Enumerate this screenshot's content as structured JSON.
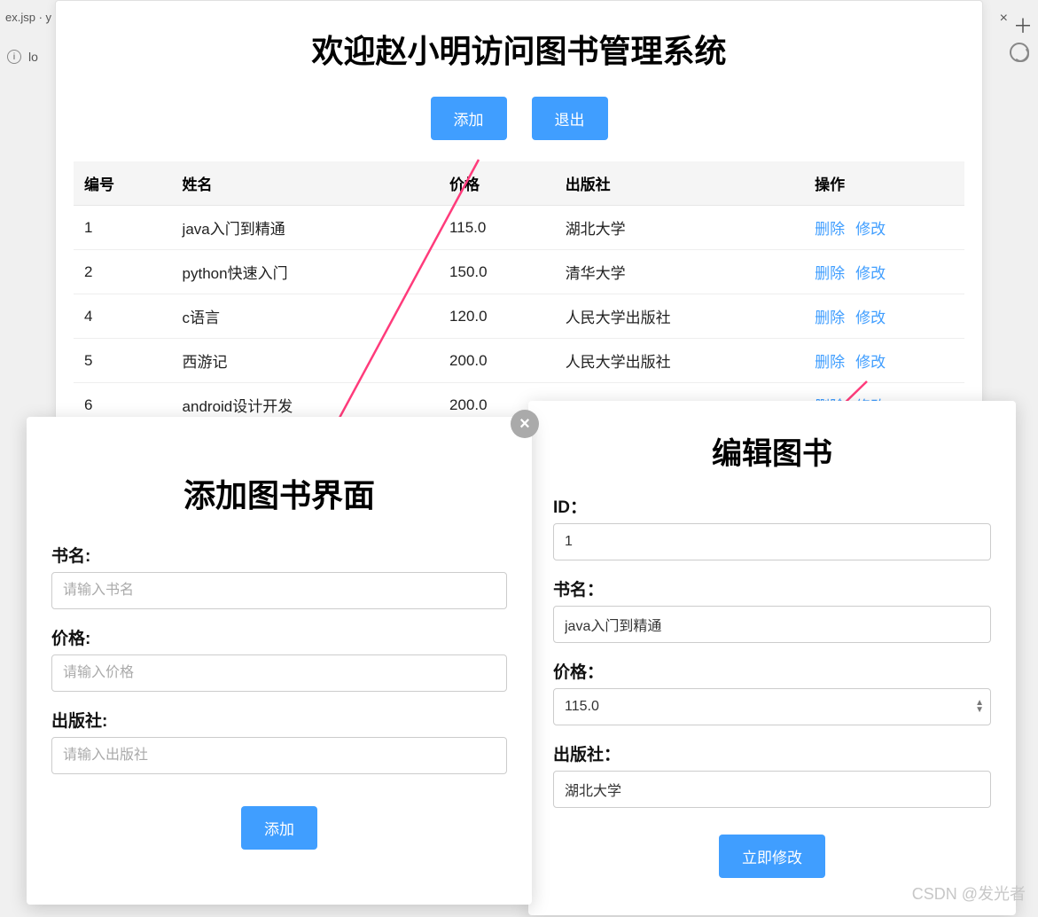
{
  "chrome": {
    "tab_fragment": "ex.jsp · y",
    "url_fragment": "lo",
    "info_icon_label": "i"
  },
  "main": {
    "title": "欢迎赵小明访问图书管理系统",
    "add_label": "添加",
    "exit_label": "退出",
    "headers": {
      "id": "编号",
      "name": "姓名",
      "price": "价格",
      "publisher": "出版社",
      "actions": "操作"
    },
    "delete_label": "删除",
    "modify_label": "修改",
    "rows": [
      {
        "id": "1",
        "name": "java入门到精通",
        "price": "115.0",
        "publisher": "湖北大学"
      },
      {
        "id": "2",
        "name": "python快速入门",
        "price": "150.0",
        "publisher": "清华大学"
      },
      {
        "id": "4",
        "name": "c语言",
        "price": "120.0",
        "publisher": "人民大学出版社"
      },
      {
        "id": "5",
        "name": "西游记",
        "price": "200.0",
        "publisher": "人民大学出版社"
      },
      {
        "id": "6",
        "name": "android设计开发",
        "price": "200.0",
        "publisher": ""
      }
    ]
  },
  "add_form": {
    "title": "添加图书界面",
    "name_label": "书名:",
    "name_placeholder": "请输入书名",
    "price_label": "价格:",
    "price_placeholder": "请输入价格",
    "publisher_label": "出版社:",
    "publisher_placeholder": "请输入出版社",
    "submit_label": "添加",
    "close_label": "×"
  },
  "edit_form": {
    "title": "编辑图书",
    "id_label": "ID：",
    "id_value": "1",
    "name_label": "书名：",
    "name_value": "java入门到精通",
    "price_label": "价格：",
    "price_value": "115.0",
    "publisher_label": "出版社：",
    "publisher_value": "湖北大学",
    "submit_label": "立即修改"
  },
  "watermark": "CSDN @发光者"
}
